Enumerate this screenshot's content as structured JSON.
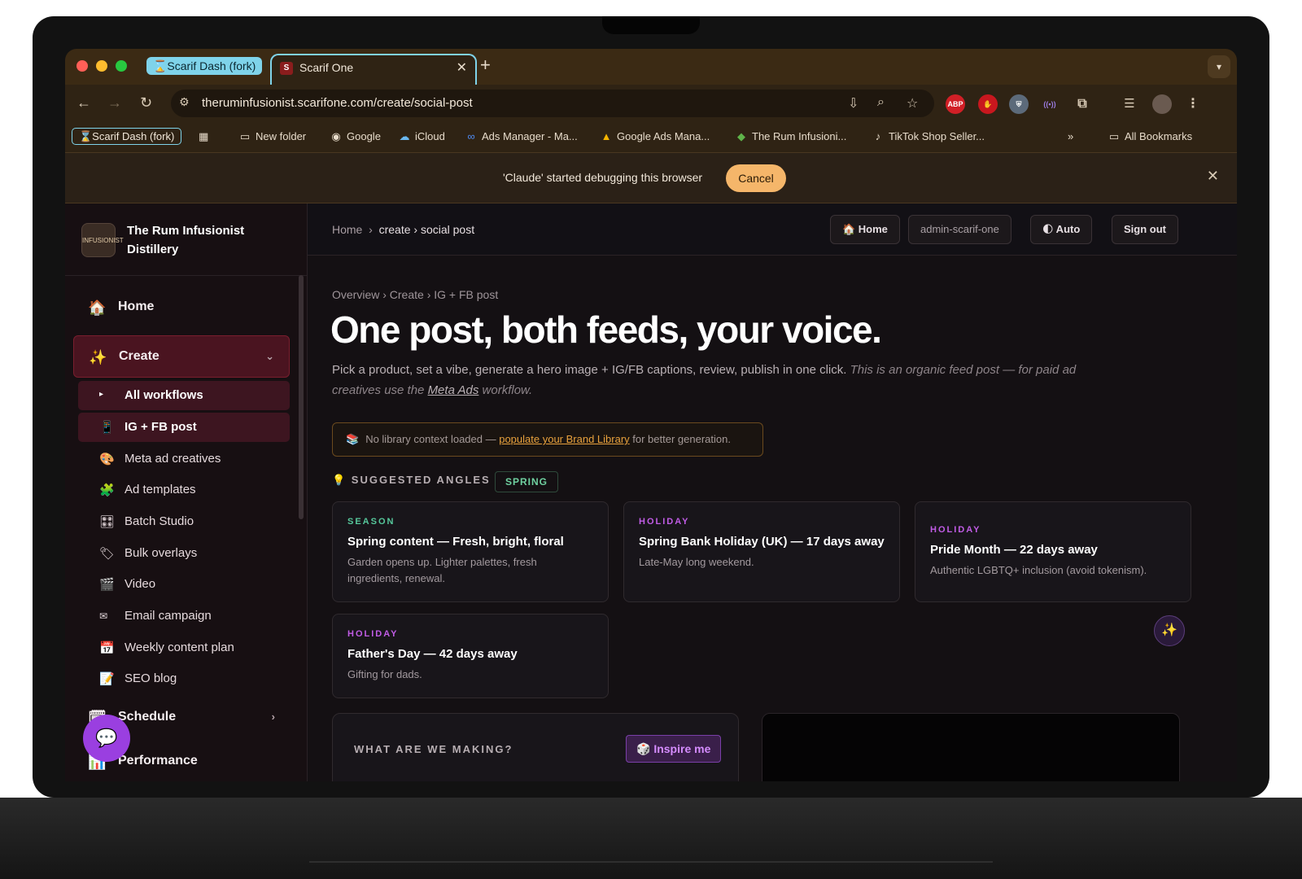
{
  "browser": {
    "tab_group_label": "⌛Scarif Dash (fork)",
    "active_tab_title": "Scarif One",
    "active_tab_favicon": "S",
    "close_glyph": "✕",
    "new_tab_glyph": "+",
    "url": "theruminfusionist.scarifone.com/create/social-post",
    "extension_abp": "ABP"
  },
  "bookmarks": {
    "group": "⌛Scarif Dash (fork)",
    "items": [
      {
        "label": "New folder",
        "icon": "folder-icon"
      },
      {
        "label": "Google",
        "icon": "google-icon"
      },
      {
        "label": "iCloud",
        "icon": "icloud-icon"
      },
      {
        "label": "Ads Manager - Ma...",
        "icon": "meta-icon"
      },
      {
        "label": "Google Ads Mana...",
        "icon": "google-ads-icon"
      },
      {
        "label": "The Rum Infusioni...",
        "icon": "shopify-icon"
      },
      {
        "label": "TikTok Shop Seller...",
        "icon": "tiktok-icon"
      }
    ],
    "more": "»",
    "all": "All Bookmarks"
  },
  "debug_bar": {
    "message": "'Claude' started debugging this browser",
    "cancel_label": "Cancel"
  },
  "sidebar": {
    "brand": "The Rum Infusionist Distillery",
    "logo_text": "INFUSIONIST",
    "items": [
      {
        "label": "Home",
        "icon": "🏠"
      },
      {
        "label": "Create",
        "icon": "✨"
      }
    ],
    "sub_items": [
      {
        "label": "All workflows",
        "icon": "▸"
      },
      {
        "label": "IG + FB post",
        "icon": "📱"
      },
      {
        "label": "Meta ad creatives",
        "icon": "🎨"
      },
      {
        "label": "Ad templates",
        "icon": "🧩"
      },
      {
        "label": "Batch Studio",
        "icon": "🎛"
      },
      {
        "label": "Bulk overlays",
        "icon": "🏷"
      },
      {
        "label": "Video",
        "icon": "🎬"
      },
      {
        "label": "Email campaign",
        "icon": "✉"
      },
      {
        "label": "Weekly content plan",
        "icon": "📅"
      },
      {
        "label": "SEO blog",
        "icon": "📝"
      }
    ],
    "schedule": {
      "label": "Schedule",
      "icon": "🗓"
    },
    "performance": {
      "label": "Performance",
      "icon": "📊"
    }
  },
  "topbar": {
    "crumb_home": "Home",
    "crumb_sep": "›",
    "crumb_path": "create › social post",
    "home_btn": "🏠 Home",
    "user_btn": "admin-scarif-one",
    "theme_btn": "🌓 Auto",
    "signout_btn": "Sign out"
  },
  "main": {
    "breadcrumb": "Overview  ›  Create  ›  IG + FB post",
    "title": "One post, both feeds, your voice.",
    "lead_plain": "Pick a product, set a vibe, generate a hero image + IG/FB captions, review, publish in one click. ",
    "lead_italic_1": "This is an organic feed post — for paid ad creatives use the ",
    "lead_link": "Meta Ads",
    "lead_italic_2": " workflow.",
    "notice_icon": "📚",
    "notice_1": "No library context loaded — ",
    "notice_link": "populate your Brand Library",
    "notice_2": " for better generation.",
    "angles_heading": "💡 SUGGESTED ANGLES",
    "spring_badge": "SPRING",
    "cards": [
      {
        "tag": "SEASON",
        "title": "Spring content — Fresh, bright, floral",
        "desc": "Garden opens up. Lighter palettes, fresh ingredients, renewal."
      },
      {
        "tag": "HOLIDAY",
        "title": "Spring Bank Holiday (UK) — 17 days away",
        "desc": "Late-May long weekend."
      },
      {
        "tag": "HOLIDAY",
        "title": "Pride Month — 22 days away",
        "desc": "Authentic LGBTQ+ inclusion (avoid tokenism)."
      },
      {
        "tag": "HOLIDAY",
        "title": "Father's Day — 42 days away",
        "desc": "Gifting for dads."
      }
    ],
    "making_heading": "WHAT ARE WE MAKING?",
    "inspire_label": "🎲 Inspire me",
    "sparkle": "✨",
    "chat": "💬"
  },
  "colors": {
    "accent_create": "#4a1420",
    "cancel_bg": "#f5b66a",
    "season_tag": "#56c79b",
    "holiday_tag": "#c15ce6",
    "chat_fab": "#9a3fe0"
  }
}
